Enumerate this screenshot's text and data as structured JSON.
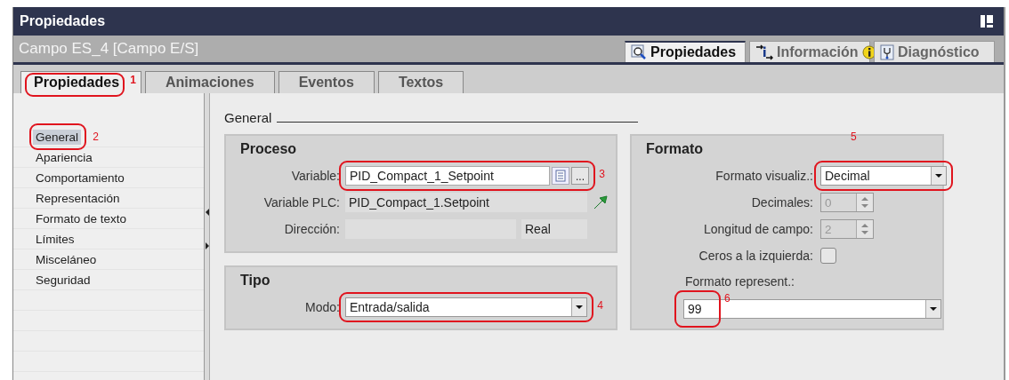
{
  "window": {
    "title": "Propiedades"
  },
  "object_title": "Campo ES_4 [Campo E/S]",
  "inspector_tabs": [
    {
      "label": "Propiedades",
      "selected": true,
      "kind": "properties",
      "badge": false
    },
    {
      "label": "Información",
      "selected": false,
      "kind": "info",
      "badge": true
    },
    {
      "label": "Diagnóstico",
      "selected": false,
      "kind": "diagnostics",
      "badge": false
    }
  ],
  "tabs": [
    {
      "label": "Propiedades",
      "selected": true,
      "callout": "1"
    },
    {
      "label": "Animaciones",
      "selected": false
    },
    {
      "label": "Eventos",
      "selected": false
    },
    {
      "label": "Textos",
      "selected": false
    }
  ],
  "sidebar": {
    "items": [
      {
        "label": "General",
        "selected": true,
        "callout": "2"
      },
      {
        "label": "Apariencia",
        "selected": false
      },
      {
        "label": "Comportamiento",
        "selected": false
      },
      {
        "label": "Representación",
        "selected": false
      },
      {
        "label": "Formato de texto",
        "selected": false
      },
      {
        "label": "Límites",
        "selected": false
      },
      {
        "label": "Misceláneo",
        "selected": false
      },
      {
        "label": "Seguridad",
        "selected": false
      }
    ]
  },
  "section_title": "General",
  "proceso": {
    "title": "Proceso",
    "variable": {
      "label": "Variable:",
      "value": "PID_Compact_1_Setpoint",
      "browse": "...",
      "callout": "3"
    },
    "variable_plc": {
      "label": "Variable PLC:",
      "value": "PID_Compact_1.Setpoint"
    },
    "direccion": {
      "label": "Dirección:",
      "type": "Real"
    }
  },
  "tipo": {
    "title": "Tipo",
    "modo": {
      "label": "Modo:",
      "value": "Entrada/salida",
      "callout": "4"
    }
  },
  "formato": {
    "title": "Formato",
    "visualiz": {
      "label": "Formato visualiz.:",
      "value": "Decimal",
      "callout": "5"
    },
    "decimales": {
      "label": "Decimales:",
      "value": "0",
      "disabled": true
    },
    "longitud": {
      "label": "Longitud de campo:",
      "value": "2",
      "disabled": true
    },
    "ceros": {
      "label": "Ceros a la izquierda:",
      "checked": false
    },
    "represent": {
      "label": "Formato represent.:",
      "value": "99",
      "callout": "6"
    }
  }
}
